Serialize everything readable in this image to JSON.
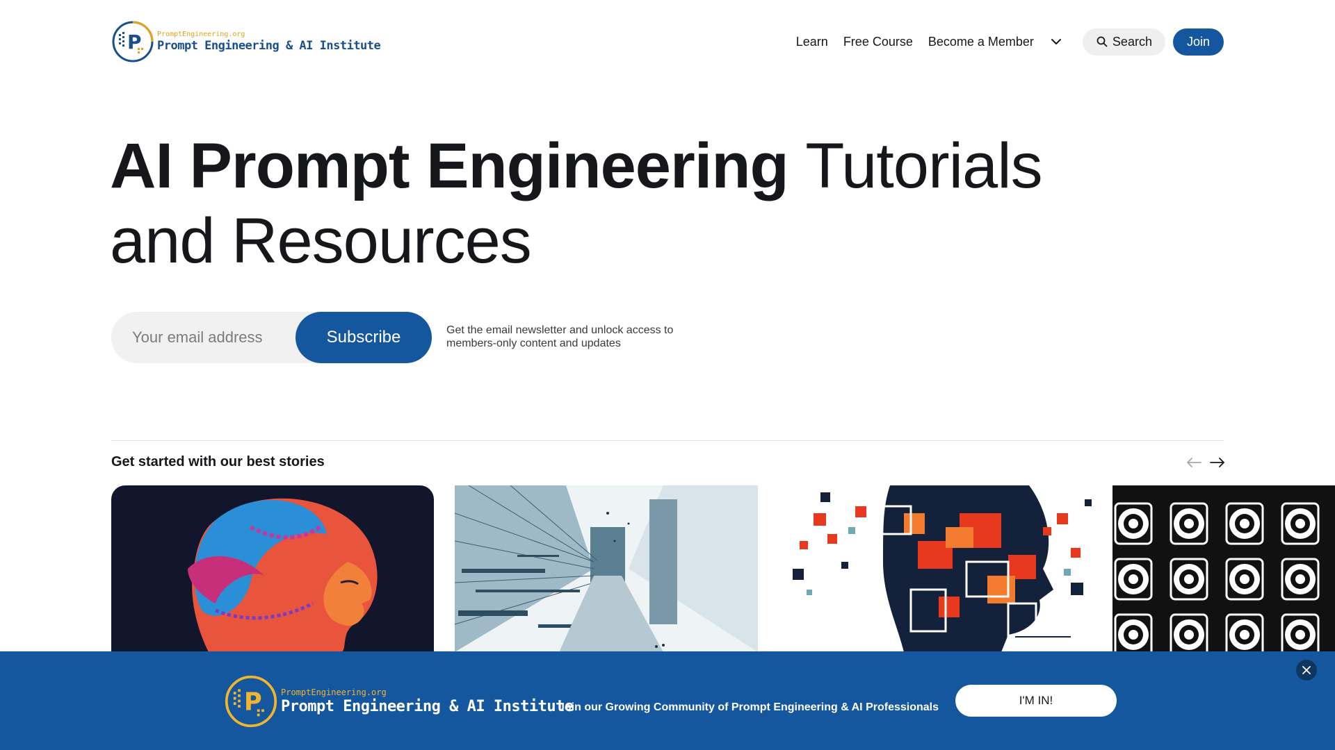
{
  "brand": {
    "domain": "PromptEngineering.org",
    "name": "Prompt Engineering & AI Institute",
    "letter": "P",
    "colors": {
      "primary": "#14579f",
      "accent": "#e2a21c"
    }
  },
  "nav": {
    "items": [
      {
        "label": "Learn"
      },
      {
        "label": "Free Course"
      },
      {
        "label": "Become a Member"
      }
    ],
    "more_icon": "chevron-down-icon",
    "search_label": "Search",
    "join_label": "Join"
  },
  "hero": {
    "title_bold": "AI Prompt Engineering",
    "title_light": "Tutorials and Resources"
  },
  "subscribe": {
    "placeholder": "Your email address",
    "button_label": "Subscribe",
    "note": "Get the email newsletter and unlock access to members-only content and updates"
  },
  "stories": {
    "heading_prefix": "Get started with our",
    "heading_bold": "best stories",
    "prev_icon": "arrow-left-icon",
    "next_icon": "arrow-right-icon",
    "cards": [
      {
        "image": "abstract-face-profile-illustration"
      },
      {
        "image": "city-street-glitch-illustration"
      },
      {
        "image": "pixel-mosaic-head-illustration"
      },
      {
        "image": "black-white-pattern-illustration"
      }
    ]
  },
  "banner": {
    "text": "Join our Growing Community of Prompt Engineering & AI Professionals",
    "cta_label": "I'M IN!",
    "close_icon": "close-icon"
  }
}
